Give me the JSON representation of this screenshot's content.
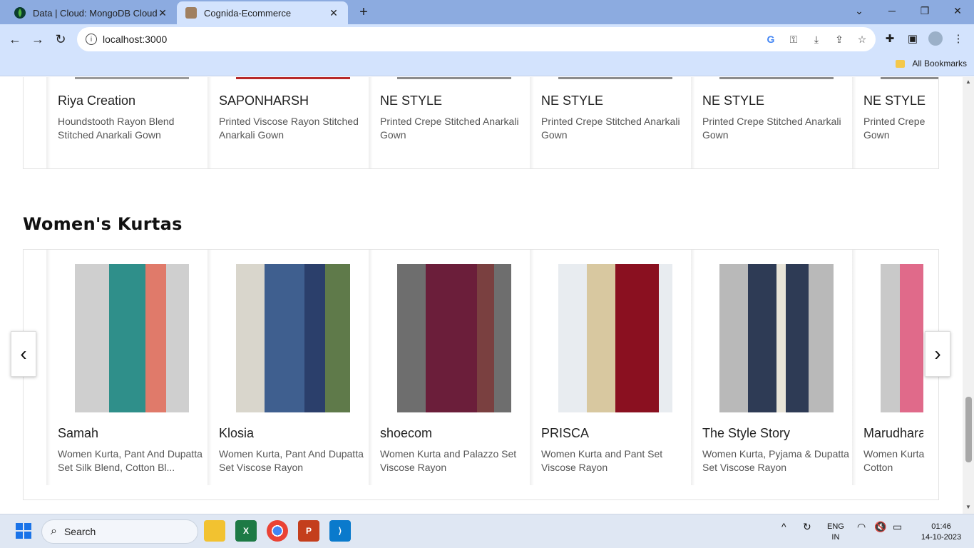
{
  "browser": {
    "tabs": [
      {
        "title": "Data | Cloud: MongoDB Cloud",
        "icon": "mongodb-leaf-icon"
      },
      {
        "title": "Cognida-Ecommerce",
        "icon": "site-favicon-icon"
      }
    ],
    "url": "localhost:3000",
    "bookmarks_label": "All Bookmarks"
  },
  "sections": {
    "previous": {
      "cards": [
        {
          "brand": "Riya Creation",
          "desc": "Houndstooth Rayon Blend Stitched Anarkali Gown"
        },
        {
          "brand": "SAPONHARSH",
          "desc": "Printed Viscose Rayon Stitched Anarkali Gown"
        },
        {
          "brand": "NE STYLE",
          "desc": "Printed Crepe Stitched Anarkali Gown"
        },
        {
          "brand": "NE STYLE",
          "desc": "Printed Crepe Stitched Anarkali Gown"
        },
        {
          "brand": "NE STYLE",
          "desc": "Printed Crepe Stitched Anarkali Gown"
        },
        {
          "brand": "NE STYLE",
          "desc": "Printed Crepe Gown"
        }
      ]
    },
    "kurtas": {
      "title": "Women's Kurtas",
      "cards": [
        {
          "brand": "Samah",
          "desc": "Women Kurta, Pant And Dupatta Set Silk Blend, Cotton Bl...",
          "color": "#2f8f8a",
          "accent": "#e07a6a"
        },
        {
          "brand": "Klosia",
          "desc": "Women Kurta, Pant And Dupatta Set Viscose Rayon",
          "color": "#3f5f8f",
          "accent": "#2b3f6b"
        },
        {
          "brand": "shoecom",
          "desc": "Women Kurta and Palazzo Set Viscose Rayon",
          "color": "#6b1e3a",
          "accent": "#7a7a7a"
        },
        {
          "brand": "PRISCA",
          "desc": "Women Kurta and Pant Set Viscose Rayon",
          "color": "#d8c8a0",
          "accent": "#8a1020"
        },
        {
          "brand": "The Style Story",
          "desc": "Women Kurta, Pyjama & Dupatta Set Viscose Rayon",
          "color": "#2e3b55",
          "accent": "#e8e4d8"
        },
        {
          "brand": "Marudhara",
          "desc": "Women Kurta Cotton",
          "color": "#e06a8a",
          "accent": "#cfcfcf"
        }
      ]
    }
  },
  "taskbar": {
    "search_label": "Search",
    "lang_line1": "ENG",
    "lang_line2": "IN",
    "time": "01:46",
    "date": "14-10-2023"
  }
}
